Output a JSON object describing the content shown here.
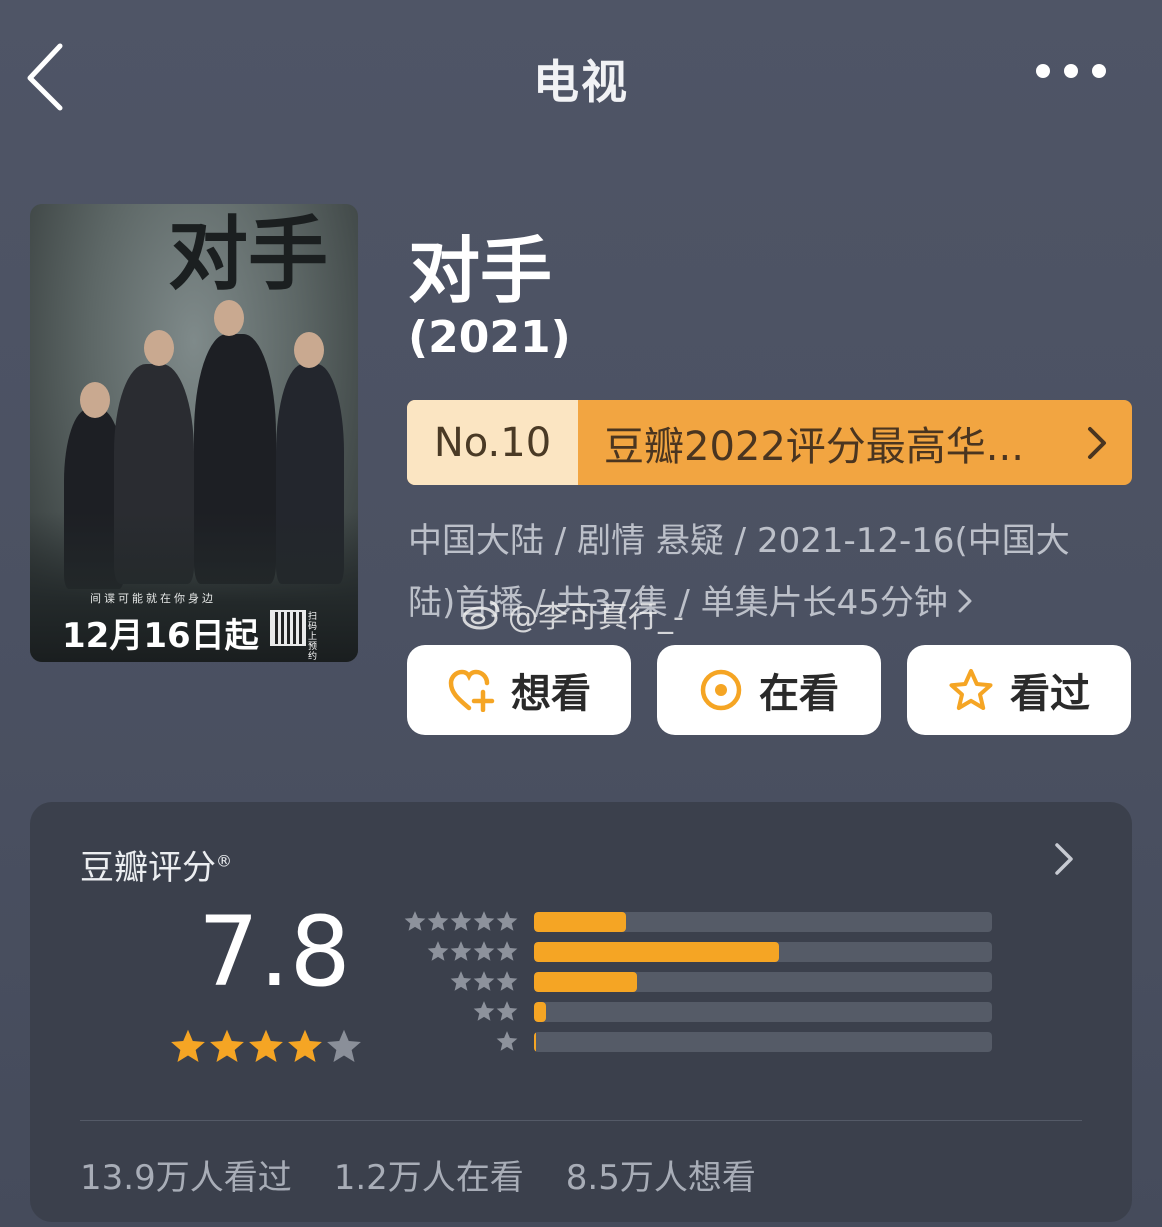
{
  "header": {
    "title": "电视"
  },
  "poster": {
    "title": "对手",
    "tagline": "间谍可能就在你身边",
    "date": "12月16日起",
    "qr_label": "扫码上预约"
  },
  "show": {
    "title": "对手",
    "year": "(2021)"
  },
  "ranking": {
    "number": "No.10",
    "text": "豆瓣2022评分最高华..."
  },
  "meta": {
    "line1": "中国大陆 / 剧情 悬疑 / 2021-12-16(中国大",
    "line2": "陆)首播 / 共37集 / 单集片长45分钟"
  },
  "watermark": {
    "text": "@李可真行_-"
  },
  "actions": [
    {
      "label": "想看",
      "icon": "heart-plus-icon"
    },
    {
      "label": "在看",
      "icon": "target-circle-icon"
    },
    {
      "label": "看过",
      "icon": "star-outline-icon"
    }
  ],
  "rating": {
    "title": "豆瓣评分",
    "registered": "®",
    "score": "7.8",
    "stars": 4,
    "distribution": [
      {
        "stars": 5,
        "fraction": 0.2
      },
      {
        "stars": 4,
        "fraction": 0.535
      },
      {
        "stars": 3,
        "fraction": 0.225
      },
      {
        "stars": 2,
        "fraction": 0.027
      },
      {
        "stars": 1,
        "fraction": 0.004
      }
    ]
  },
  "stats": {
    "watched": "13.9万人看过",
    "watching": "1.2万人在看",
    "want": "8.5万人想看"
  },
  "colors": {
    "accent_orange": "#f5a524",
    "rank_bg": "#f2a541",
    "rank_no_bg": "#fbe5c2",
    "card_bg": "#3b404c"
  }
}
